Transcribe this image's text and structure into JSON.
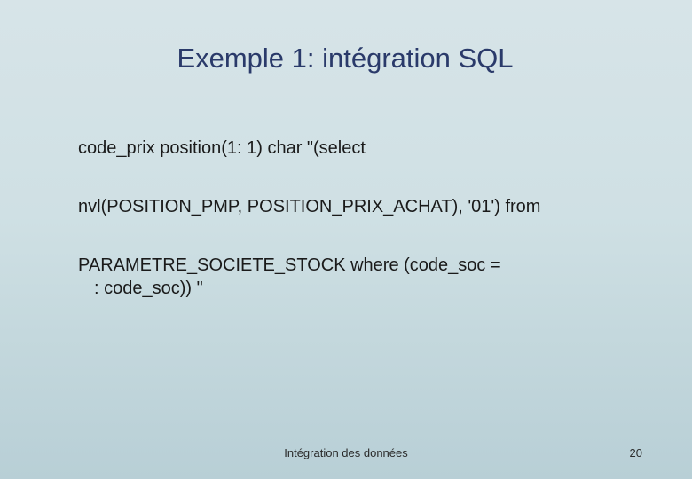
{
  "slide": {
    "title": "Exemple 1: intégration SQL",
    "body": {
      "line1": "code_prix position(1: 1)   char   \"(select",
      "line2": "nvl(POSITION_PMP, POSITION_PRIX_ACHAT), '01') from",
      "line3a": "PARAMETRE_SOCIETE_STOCK where (code_soc =",
      "line3b": ": code_soc))  \""
    },
    "footer": "Intégration des données",
    "page_number": "20"
  }
}
